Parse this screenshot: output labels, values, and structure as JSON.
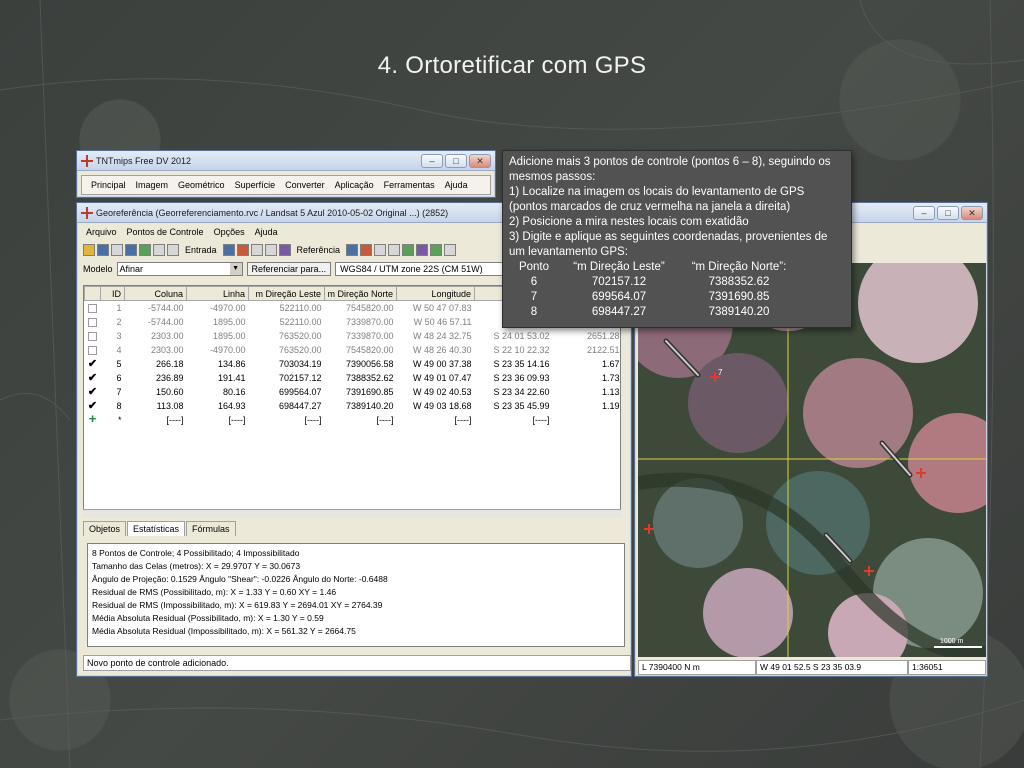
{
  "slide": {
    "title": "4. Ortoretificar com GPS"
  },
  "tnt_window": {
    "title": "TNTmips Free DV 2012",
    "menu": [
      "Principal",
      "Imagem",
      "Geométrico",
      "Superfície",
      "Converter",
      "Aplicação",
      "Ferramentas",
      "Ajuda"
    ]
  },
  "geo_window": {
    "title": "Georeferência (Georreferenciamento.rvc / Landsat 5 Azul 2010-05-02 Original ...) (2852)",
    "menu": [
      "Arquivo",
      "Pontos de Controle",
      "Opções",
      "Ajuda"
    ],
    "toolbar": {
      "entrada_label": "Entrada",
      "referencia_label": "Referência"
    },
    "model": {
      "label": "Modelo",
      "value": "Afinar",
      "ref_button": "Referenciar para...",
      "projection": "WGS84 / UTM zone 22S (CM 51W)"
    },
    "columns": [
      "ID",
      "Coluna",
      "Linha",
      "m Direção Leste",
      "m Direção Norte",
      "Longitude",
      "",
      ""
    ],
    "rows": [
      {
        "check": "",
        "id": "1",
        "coluna": "-5744.00",
        "linha": "-4970.00",
        "leste": "522110.00",
        "norte": "7545820.00",
        "lon": "W 50 47 07.83",
        "lat": "S 22",
        "res": "",
        "active": false
      },
      {
        "check": "",
        "id": "2",
        "coluna": "-5744.00",
        "linha": "1895.00",
        "leste": "522110.00",
        "norte": "7339870.00",
        "lon": "W 50 46 57.11",
        "lat": "S 24",
        "res": "",
        "active": false
      },
      {
        "check": "",
        "id": "3",
        "coluna": "2303.00",
        "linha": "1895.00",
        "leste": "763520.00",
        "norte": "7339870.00",
        "lon": "W 48 24 32.75",
        "lat": "S 24 01 53.02",
        "res": "2651.28",
        "active": false
      },
      {
        "check": "",
        "id": "4",
        "coluna": "2303.00",
        "linha": "-4970.00",
        "leste": "763520.00",
        "norte": "7545820.00",
        "lon": "W 48 26 40.30",
        "lat": "S 22 10 22.32",
        "res": "2122.51",
        "active": false
      },
      {
        "check": "✔",
        "id": "5",
        "coluna": "266.18",
        "linha": "134.86",
        "leste": "703034.19",
        "norte": "7390056.58",
        "lon": "W 49 00 37.38",
        "lat": "S 23 35 14.16",
        "res": "1.67",
        "active": true
      },
      {
        "check": "✔",
        "id": "6",
        "coluna": "236.89",
        "linha": "191.41",
        "leste": "702157.12",
        "norte": "7388352.62",
        "lon": "W 49 01 07.47",
        "lat": "S 23 36 09.93",
        "res": "1.73",
        "active": true
      },
      {
        "check": "✔",
        "id": "7",
        "coluna": "150.60",
        "linha": "80.16",
        "leste": "699564.07",
        "norte": "7391690.85",
        "lon": "W 49 02 40.53",
        "lat": "S 23 34 22.60",
        "res": "1.13",
        "active": true
      },
      {
        "check": "✔",
        "id": "8",
        "coluna": "113.08",
        "linha": "164.93",
        "leste": "698447.27",
        "norte": "7389140.20",
        "lon": "W 49 03 18.68",
        "lat": "S 23 35 45.99",
        "res": "1.19",
        "active": true
      },
      {
        "check": "+",
        "id": "*",
        "coluna": "[----]",
        "linha": "[----]",
        "leste": "[----]",
        "norte": "[----]",
        "lon": "[----]",
        "lat": "[----]",
        "res": "",
        "active": true
      }
    ],
    "tabs": [
      "Objetos",
      "Estatísticas",
      "Fórmulas"
    ],
    "stats": [
      "8 Pontos de Controle;  4 Possibilitado;  4 Impossibilitado",
      "Tamanho das Celas (metros):  X = 29.9707  Y = 30.0673",
      "Ângulo de Projeção: 0.1529  Ângulo \"Shear\": -0.0226  Ângulo do Norte: -0.6488",
      "Residual de RMS (Possibilitado, m):  X = 1.33  Y = 0.60  XY = 1.46",
      "Residual de RMS (Impossibilitado, m):  X = 619.83  Y = 2694.01  XY = 2764.39",
      "Média Absoluta Residual (Possibilitado, m):  X = 1.30  Y = 0.59",
      "Média Absoluta Residual (Impossibilitado, m):  X = 561.32  Y = 2664.75"
    ],
    "status": "Novo ponto de controle adicionado."
  },
  "map_window": {
    "status_north": "L 7390400 N m",
    "status_coords": "W 49 01 52.5  S 23 35 03.9",
    "status_scale": "1:36051",
    "scale_label": "1000 m",
    "point_label": "7"
  },
  "note": {
    "intro": "Adicione mais 3 pontos de controle (pontos 6 – 8), seguindo os mesmos passos:",
    "step1": "1)  Localize na imagem os locais do levantamento de GPS (pontos marcados de cruz vermelha na janela a direita)",
    "step2": "2) Posicione a mira nestes locais com exatidão",
    "step3": "3) Digite e aplique as seguintes coordenadas, provenientes de um levantamento GPS:",
    "headers": [
      "Ponto",
      "“m Direção Leste”",
      "“m Direção Norte”:"
    ],
    "points": [
      [
        "6",
        "702157.12",
        "7388352.62"
      ],
      [
        "7",
        "699564.07",
        "7391690.85"
      ],
      [
        "8",
        "698447.27",
        "7389140.20"
      ]
    ]
  }
}
